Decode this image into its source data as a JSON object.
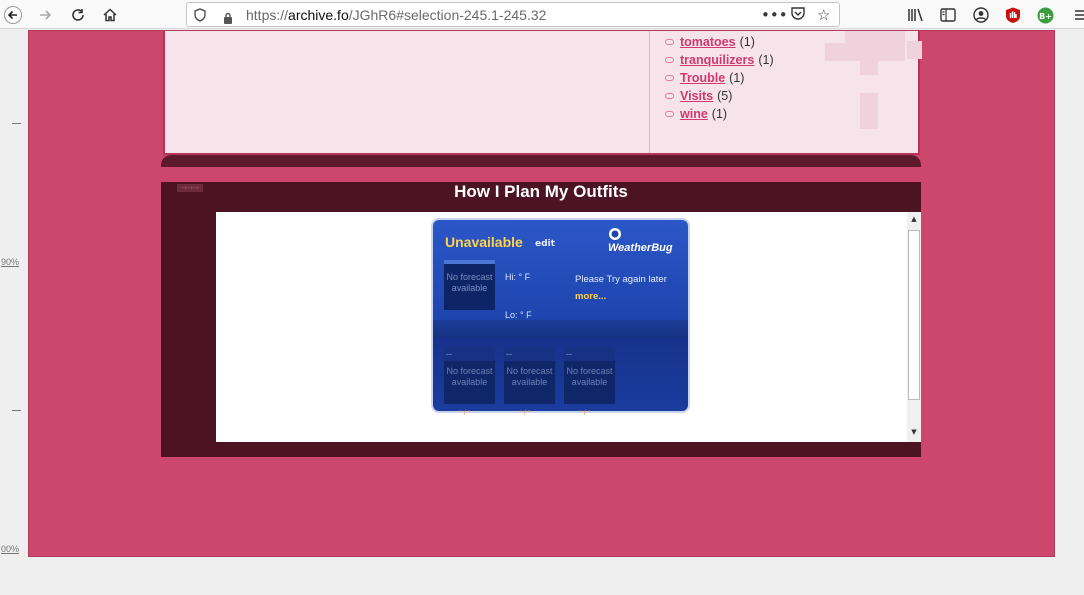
{
  "browser": {
    "url_prefix": "https://",
    "url_host": "archive.fo",
    "url_path": "/JGhR6#selection-245.1-245.32",
    "icons": [
      "back-icon",
      "forward-icon",
      "reload-icon",
      "home-icon",
      "shield-icon",
      "lock-icon",
      "more-icon",
      "pocket-icon",
      "bookmark-star-icon",
      "library-icon",
      "sidebar-icon",
      "account-icon",
      "ublock-icon",
      "extension-icon",
      "menu-icon"
    ],
    "ext_badge": "B+"
  },
  "ruler": {
    "mark1": "90%",
    "mark2": "00%"
  },
  "tags": [
    {
      "name": "tomatoes",
      "count": "(1)"
    },
    {
      "name": "tranquilizers",
      "count": "(1)"
    },
    {
      "name": "Trouble",
      "count": "(1)"
    },
    {
      "name": "Visits",
      "count": "(5)"
    },
    {
      "name": "wine",
      "count": "(1)"
    }
  ],
  "post": {
    "title": "How I Plan My Outfits"
  },
  "weather": {
    "location": "Unavailable",
    "edit": "edit",
    "brand": "WeatherBug",
    "today_text": "No forecast available",
    "hi": "Hi:  ° F",
    "lo": "Lo:  ° F",
    "message": "Please Try again later",
    "more": "more...",
    "forecast": [
      {
        "dash": "--",
        "text": "No forecast available"
      },
      {
        "dash": "--",
        "text": "No forecast available"
      },
      {
        "dash": "--",
        "text": "No forecast available"
      }
    ],
    "temps": "° / °"
  },
  "colors": {
    "page_bg": "#cd466c",
    "panel_bg": "#f7e4ea",
    "post_bg": "#4c1322",
    "link": "#d2386e",
    "weather_accent": "#ffd24a"
  }
}
